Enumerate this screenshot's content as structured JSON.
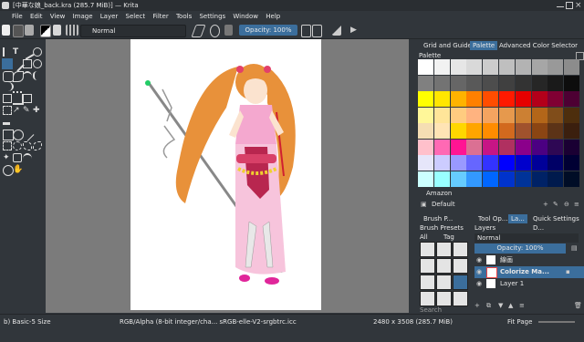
{
  "window": {
    "title": "[中華な娘_back.kra (285.7 MiB)] — Krita"
  },
  "menu": [
    "File",
    "Edit",
    "View",
    "Image",
    "Layer",
    "Select",
    "Filter",
    "Tools",
    "Settings",
    "Window",
    "Help"
  ],
  "toolbar": {
    "blend_mode": "Normal",
    "opacity": "Opacity: 100%"
  },
  "dock_tabs": [
    "Grid and Guides",
    "Palette",
    "Advanced Color Selector"
  ],
  "palette": {
    "title": "Palette",
    "colors": [
      [
        "#ffffff",
        "#f2f2f2",
        "#e6e6e6",
        "#d9d9d9",
        "#cccccc",
        "#bfbfbf",
        "#b3b3b3",
        "#a6a6a6",
        "#999999",
        "#8c8c8c"
      ],
      [
        "#808080",
        "#737373",
        "#666666",
        "#595959",
        "#4d4d4d",
        "#404040",
        "#333333",
        "#262626",
        "#1a1a1a",
        "#0d0d0d"
      ],
      [
        "#ffff00",
        "#ffe600",
        "#ffb300",
        "#ff8000",
        "#ff4d00",
        "#ff1a00",
        "#e60000",
        "#b3001a",
        "#800033",
        "#4d0033"
      ],
      [
        "#fff799",
        "#ffe599",
        "#ffcc80",
        "#ffb380",
        "#f4a460",
        "#e6994d",
        "#cc8033",
        "#b36619",
        "#804d1a",
        "#4d2e0d"
      ],
      [
        "#f5deb3",
        "#ffe4b5",
        "#ffd700",
        "#ffa500",
        "#ff8c00",
        "#d2691e",
        "#a0522d",
        "#8b4513",
        "#5c3317",
        "#3b1f0e"
      ],
      [
        "#ffc0cb",
        "#ff69b4",
        "#ff1493",
        "#db7093",
        "#c71585",
        "#b03060",
        "#8b008b",
        "#4b0082",
        "#2e0854",
        "#1a0033"
      ],
      [
        "#e6e6fa",
        "#ccccff",
        "#9999ff",
        "#6666ff",
        "#3333ff",
        "#0000ff",
        "#0000cc",
        "#000099",
        "#000066",
        "#000033"
      ],
      [
        "#ccffff",
        "#99ffff",
        "#66ccff",
        "#3399ff",
        "#0066ff",
        "#0033cc",
        "#003399",
        "#002266",
        "#001a4d",
        "#000d26"
      ]
    ],
    "palette_name": "Amazon",
    "palette_set": "Default"
  },
  "lower_tabs": [
    "Brush P...",
    "Tool Op...",
    "La...",
    "Quick Settings D..."
  ],
  "brush_filter": {
    "label": "All",
    "tag": "Tag"
  },
  "layers": {
    "title": "Layers",
    "blend_mode": "Normal",
    "opacity": "Opacity: 100%",
    "items": [
      {
        "name": "線画",
        "selected": false
      },
      {
        "name": "Colorize Ma...",
        "selected": true
      },
      {
        "name": "Layer 1",
        "selected": false
      }
    ]
  },
  "search_placeholder": "Search",
  "status": {
    "brush": "b) Basic-5 Size",
    "color_space": "RGB/Alpha (8-bit integer/cha...  sRGB-elle-V2-srgbtrc.icc",
    "dimensions": "2480 x 3508 (285.7 MiB)",
    "zoom": "Fit Page"
  }
}
